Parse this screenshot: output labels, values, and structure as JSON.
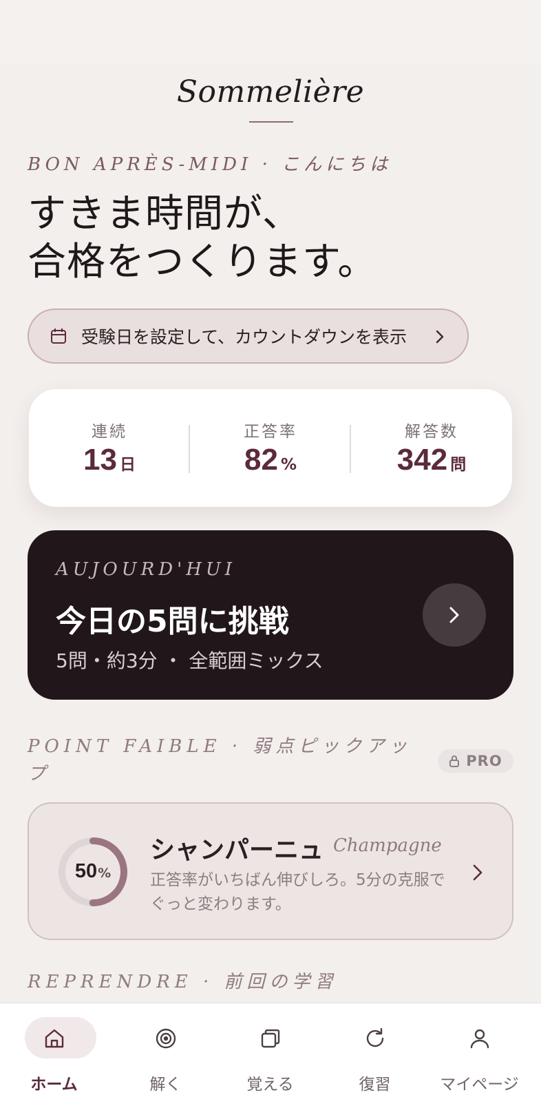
{
  "app": {
    "title": "Sommelière"
  },
  "greeting": "BON APRÈS-MIDI · こんにちは",
  "hero": {
    "line1": "すきま時間が、",
    "line2": "合格をつくります。"
  },
  "exam_pill": {
    "label": "受験日を設定して、カウントダウンを表示",
    "icon": "calendar-icon"
  },
  "stats": [
    {
      "label": "連続",
      "value": "13",
      "unit": "日"
    },
    {
      "label": "正答率",
      "value": "82",
      "unit": "%"
    },
    {
      "label": "解答数",
      "value": "342",
      "unit": "問"
    }
  ],
  "challenge": {
    "kicker": "AUJOURD'HUI",
    "title": "今日の5問に挑戦",
    "subtitle": "5問・約3分 ・ 全範囲ミックス"
  },
  "weak": {
    "heading": "POINT FAIBLE · 弱点ピックアップ",
    "badge": "PRO",
    "card": {
      "percent": "50",
      "percent_unit": "%",
      "progress": 0.5,
      "name": "シャンパーニュ",
      "latin": "Champagne",
      "description": "正答率がいちばん伸びしろ。5分の克服でぐっと変わります。"
    }
  },
  "resume": {
    "heading": "REPRENDRE · 前回の学習"
  },
  "tabbar": [
    {
      "label": "ホーム",
      "icon": "home-icon",
      "active": true
    },
    {
      "label": "解く",
      "icon": "target-icon",
      "active": false
    },
    {
      "label": "覚える",
      "icon": "cards-icon",
      "active": false
    },
    {
      "label": "復習",
      "icon": "refresh-icon",
      "active": false
    },
    {
      "label": "マイページ",
      "icon": "user-icon",
      "active": false
    }
  ],
  "colors": {
    "accent": "#5b2a3b",
    "background": "#f3efec",
    "dark_card": "#21171b",
    "ring_progress": "#9a7680",
    "ring_track": "#ddd5d6"
  }
}
